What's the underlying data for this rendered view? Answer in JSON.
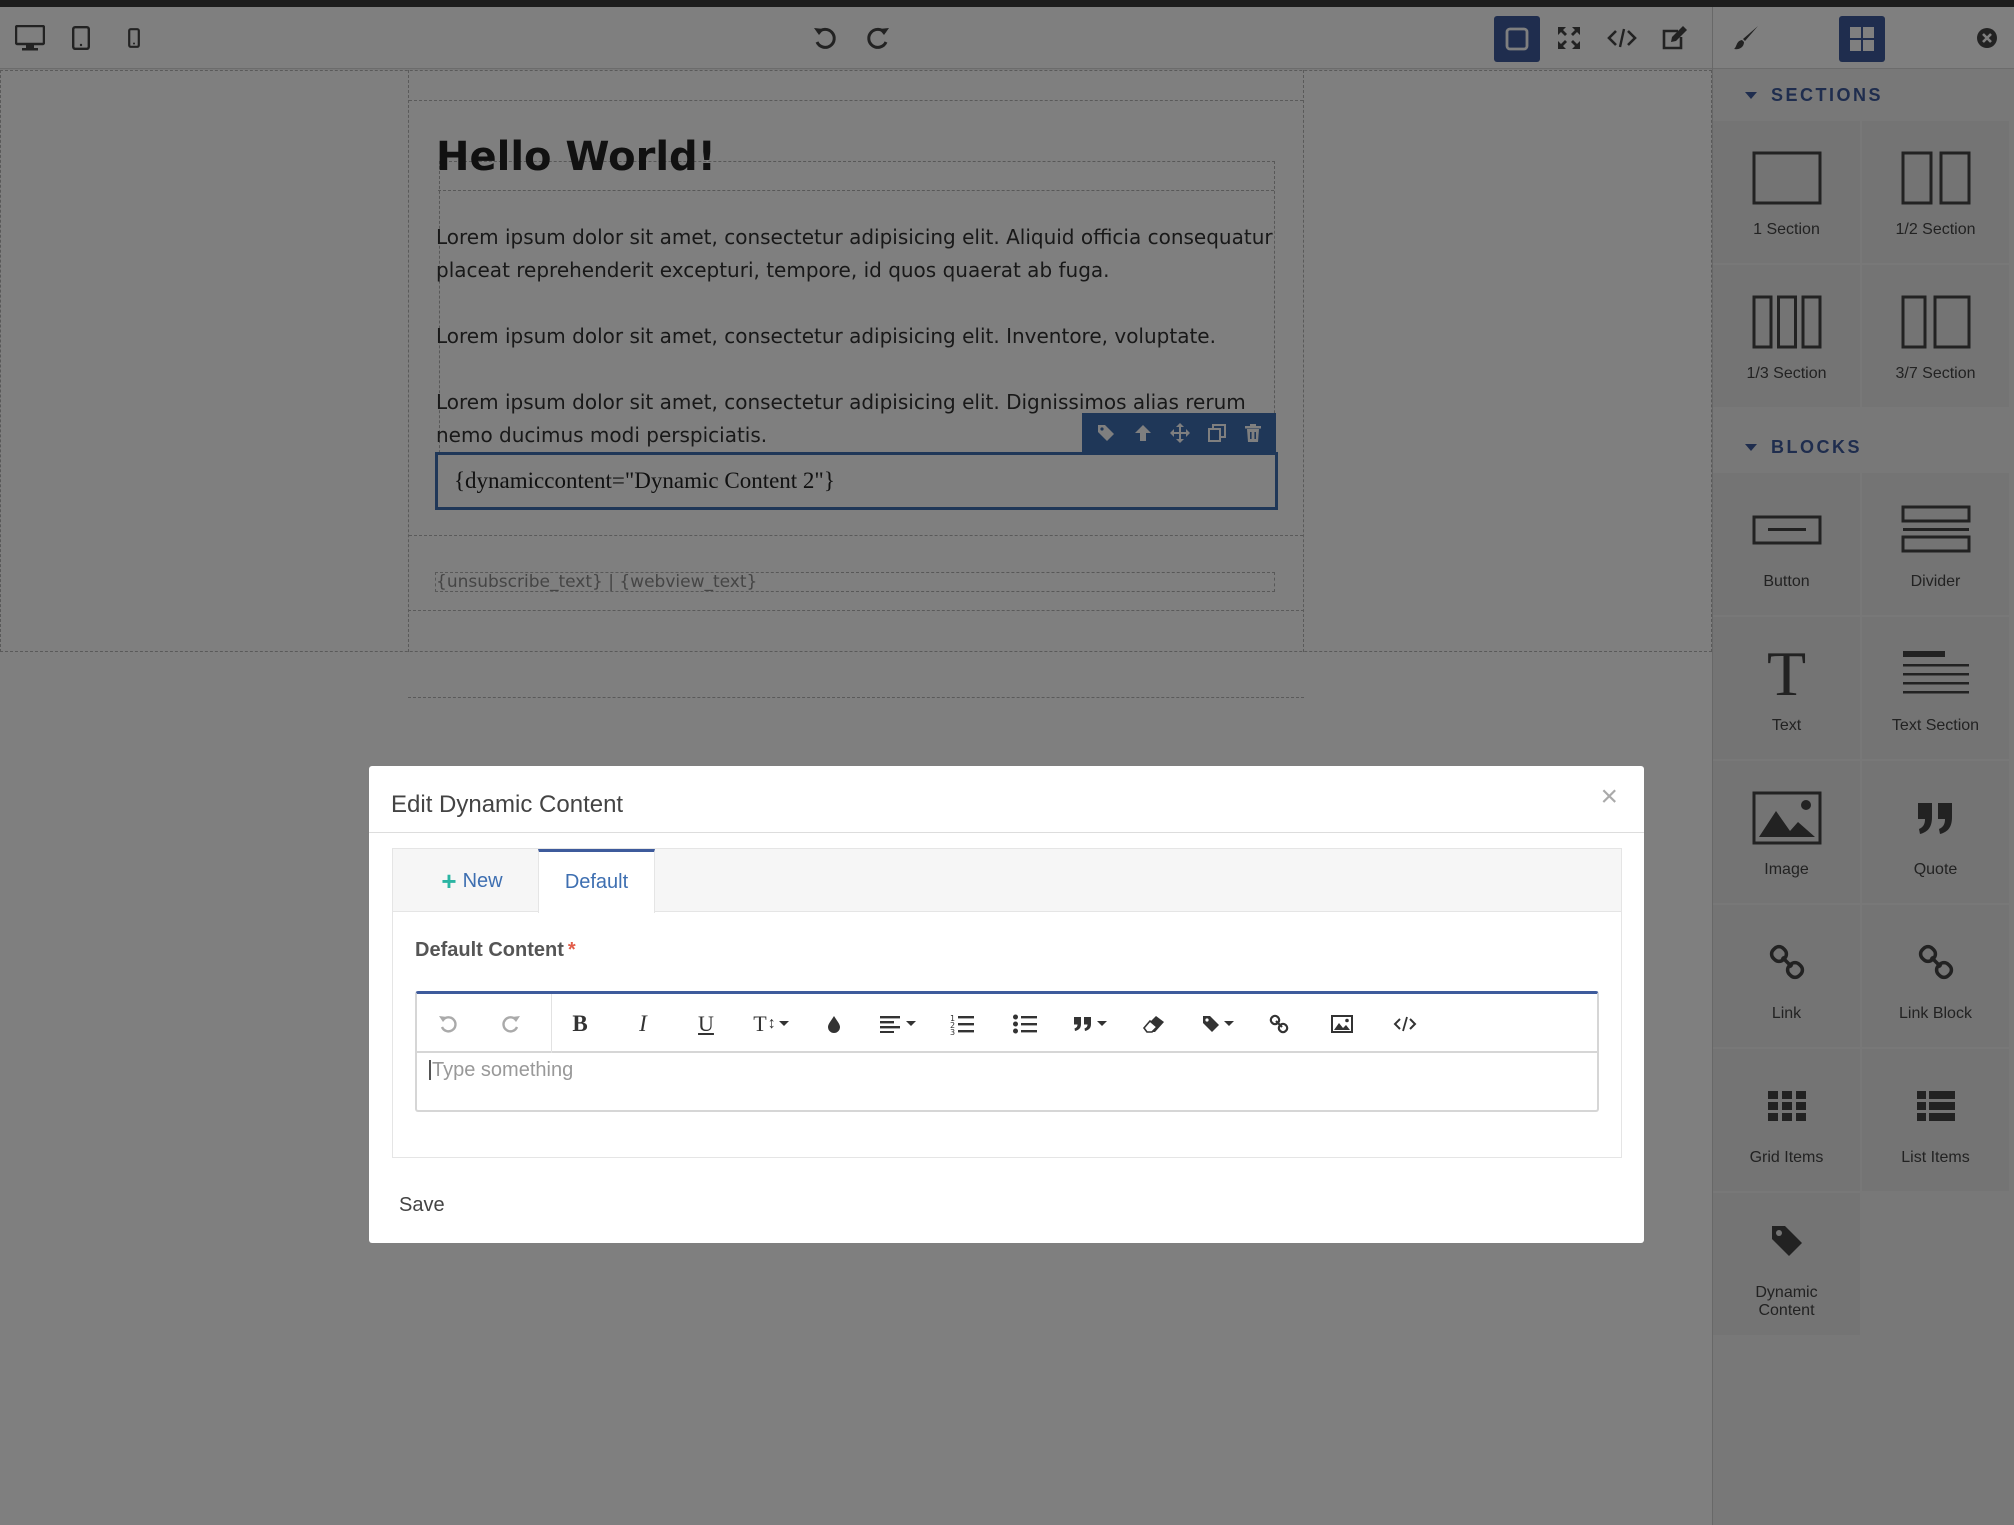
{
  "toolbar": {
    "device_icons": [
      "desktop-icon",
      "tablet-icon",
      "mobile-icon"
    ],
    "history_icons": [
      "undo-icon",
      "redo-icon"
    ],
    "view_icons": [
      "border-toggle-icon",
      "fullscreen-icon",
      "code-icon",
      "edit-icon"
    ]
  },
  "panel": {
    "tabs": [
      "brush-icon",
      "blocks-icon",
      "close-icon"
    ],
    "sections_header": "SECTIONS",
    "sections": [
      {
        "label": "1 Section",
        "icon": "one-section-icon"
      },
      {
        "label": "1/2 Section",
        "icon": "half-section-icon"
      },
      {
        "label": "1/3 Section",
        "icon": "third-section-icon"
      },
      {
        "label": "3/7 Section",
        "icon": "three-seven-section-icon"
      }
    ],
    "blocks_header": "BLOCKS",
    "blocks": [
      {
        "label": "Button",
        "icon": "button-icon"
      },
      {
        "label": "Divider",
        "icon": "divider-icon"
      },
      {
        "label": "Text",
        "icon": "text-icon"
      },
      {
        "label": "Text Section",
        "icon": "text-section-icon"
      },
      {
        "label": "Image",
        "icon": "image-icon"
      },
      {
        "label": "Quote",
        "icon": "quote-icon"
      },
      {
        "label": "Link",
        "icon": "link-icon"
      },
      {
        "label": "Link Block",
        "icon": "link-block-icon"
      },
      {
        "label": "Grid Items",
        "icon": "grid-icon"
      },
      {
        "label": "List Items",
        "icon": "list-icon"
      },
      {
        "label": "Dynamic Content",
        "icon": "tag-icon"
      }
    ]
  },
  "email": {
    "heading": "Hello World!",
    "paragraphs": [
      "Lorem ipsum dolor sit amet, consectetur adipisicing elit. Aliquid officia consequatur placeat reprehenderit excepturi, tempore, id quos quaerat ab fuga.",
      "Lorem ipsum dolor sit amet, consectetur adipisicing elit. Inventore, voluptate.",
      "Lorem ipsum dolor sit amet, consectetur adipisicing elit. Dignissimos alias rerum nemo ducimus modi perspiciatis."
    ],
    "dynamic_block": "{dynamiccontent=\"Dynamic Content 2\"}",
    "footer": "{unsubscribe_text} | {webview_text}"
  },
  "modal": {
    "title": "Edit Dynamic Content",
    "close": "×",
    "tabs": {
      "new": "New",
      "default": "Default"
    },
    "field_label": "Default Content",
    "required_mark": "*",
    "editor_placeholder": "Type something",
    "save": "Save"
  },
  "colors": {
    "accent": "#3e5b9c",
    "block_highlight": "#3e6fb1",
    "plus": "#2bb5a3",
    "required": "#e25d4a"
  }
}
